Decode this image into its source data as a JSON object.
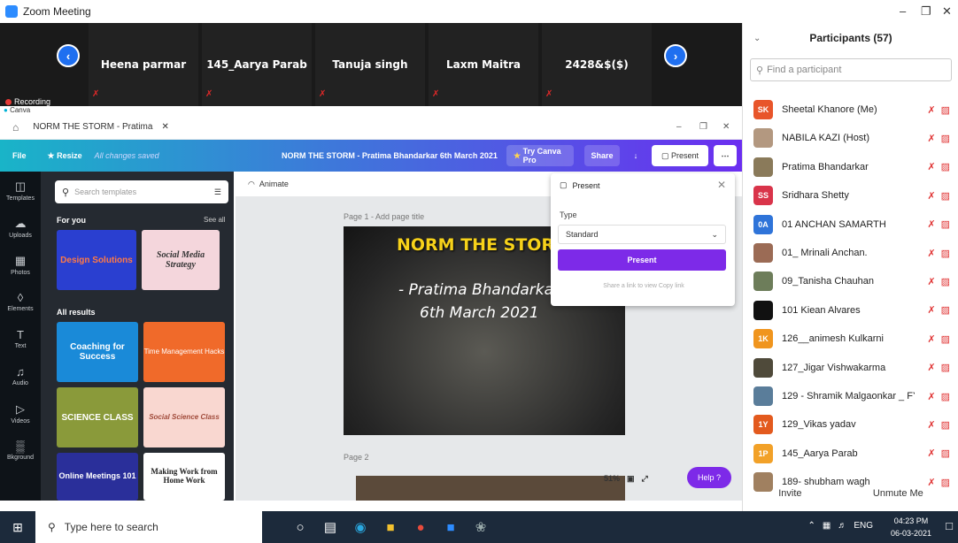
{
  "zoom": {
    "window_title": "Zoom Meeting",
    "recording_label": "Recording",
    "video_tiles": [
      "Heena parmar",
      "145_Aarya Parab",
      "Tanuja singh",
      "Laxm Maitra",
      "2428&$($)"
    ]
  },
  "canva": {
    "window_title": "Canva",
    "tab_title": "NORM THE STORM - Pratima",
    "menu_file": "File",
    "menu_resize": "Resize",
    "saved_status": "All changes saved",
    "doc_title": "NORM THE STORM - Pratima Bhandarkar 6th March 2021",
    "try_pro": "Try Canva Pro",
    "share": "Share",
    "present": "Present",
    "nav": [
      {
        "label": "Templates",
        "icon": "templates-icon"
      },
      {
        "label": "Uploads",
        "icon": "uploads-icon"
      },
      {
        "label": "Photos",
        "icon": "photos-icon"
      },
      {
        "label": "Elements",
        "icon": "elements-icon"
      },
      {
        "label": "Text",
        "icon": "text-icon"
      },
      {
        "label": "Audio",
        "icon": "audio-icon"
      },
      {
        "label": "Videos",
        "icon": "videos-icon"
      },
      {
        "label": "Bkground",
        "icon": "background-icon"
      }
    ],
    "search_placeholder": "Search templates",
    "for_you": "For you",
    "see_all": "See all",
    "all_results": "All results",
    "cards": [
      "Design Solutions",
      "Social Media Strategy",
      "Coaching for Success",
      "Time Management Hacks",
      "SCIENCE CLASS",
      "Social Science Class",
      "Online Meetings 101",
      "Making Work from Home Work"
    ],
    "animate": "Animate",
    "page1_label": "Page 1 - Add page title",
    "page2_label": "Page 2",
    "slide_title": "NORM THE STORM",
    "slide_author": "- Pratima Bhandarka",
    "slide_date": "6th March 2021",
    "zoom_level": "51%",
    "help": "Help ?",
    "present_panel": {
      "title": "Present",
      "type_label": "Type",
      "type_value": "Standard",
      "button": "Present",
      "share_text": "Share a link to view Copy link"
    }
  },
  "participants": {
    "title": "Participants (57)",
    "find_placeholder": "Find a participant",
    "list": [
      {
        "initials": "SK",
        "name": "Sheetal Khanore (Me)",
        "color": "#e8552a"
      },
      {
        "initials": "",
        "name": "NABILA KAZI (Host)",
        "color": "#b39880"
      },
      {
        "initials": "",
        "name": "Pratima Bhandarkar",
        "color": "#8a7a5a"
      },
      {
        "initials": "SS",
        "name": "Sridhara Shetty",
        "color": "#d9344a"
      },
      {
        "initials": "0A",
        "name": "01 ANCHAN SAMARTH",
        "color": "#2f74d9"
      },
      {
        "initials": "",
        "name": "01_ Mrinali Anchan.",
        "color": "#9b6b55"
      },
      {
        "initials": "",
        "name": "09_Tanisha Chauhan",
        "color": "#6d7d5a"
      },
      {
        "initials": "",
        "name": "101 Kiean Alvares",
        "color": "#111111"
      },
      {
        "initials": "1K",
        "name": "126__animesh Kulkarni",
        "color": "#f0951e"
      },
      {
        "initials": "",
        "name": "127_Jigar Vishwakarma",
        "color": "#4f4a3a"
      },
      {
        "initials": "",
        "name": "129 - Shramik Malgaonkar _ FY...",
        "color": "#5a7d9a"
      },
      {
        "initials": "1Y",
        "name": "129_Vikas yadav",
        "color": "#e35a1e"
      },
      {
        "initials": "1P",
        "name": "145_Aarya Parab",
        "color": "#f2a128"
      },
      {
        "initials": "",
        "name": "189- shubham wagh",
        "color": "#a08060"
      }
    ],
    "invite": "Invite",
    "unmute_me": "Unmute Me"
  },
  "taskbar": {
    "search_placeholder": "Type here to search",
    "lang": "ENG",
    "time": "04:23 PM",
    "date": "06-03-2021"
  }
}
